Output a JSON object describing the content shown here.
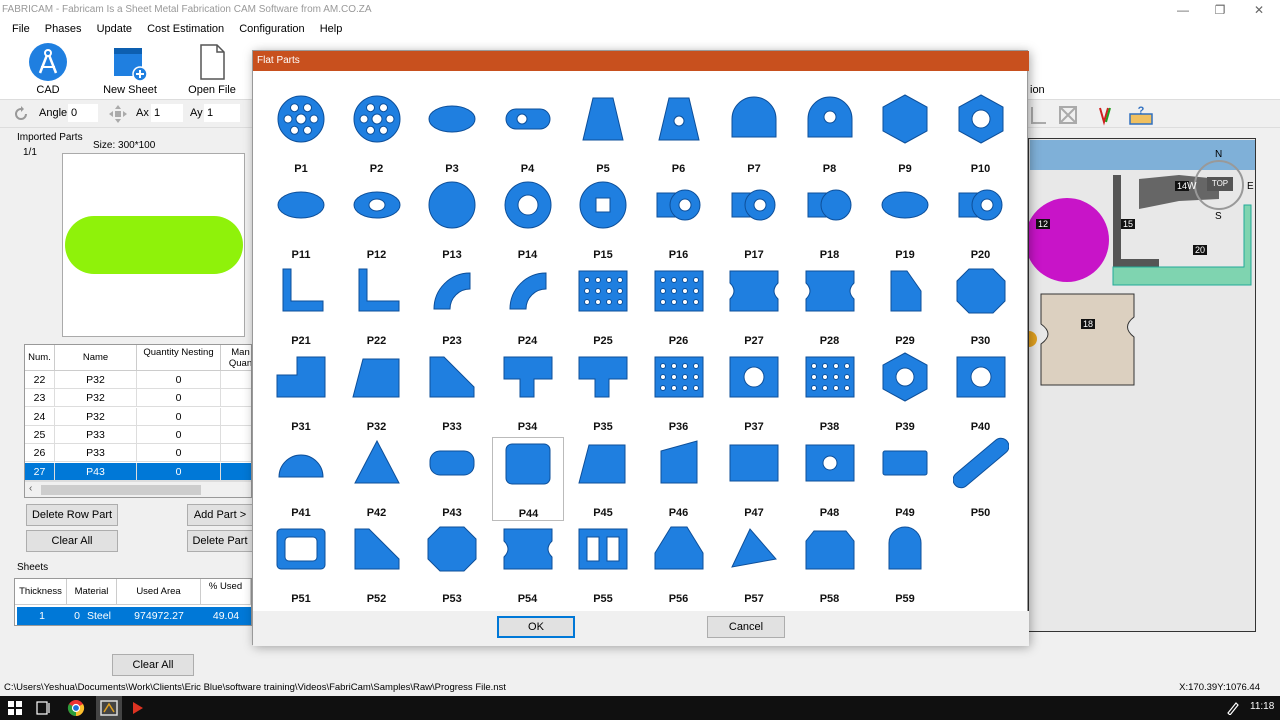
{
  "window": {
    "title": "FABRICAM - Fabricam Is a Sheet Metal Fabrication CAM Software from AM.CO.ZA",
    "minimize": "—",
    "maximize": "❐",
    "close": "✕"
  },
  "menu": [
    "File",
    "Phases",
    "Update",
    "Cost Estimation",
    "Configuration",
    "Help"
  ],
  "ribbon": {
    "cad": "CAD",
    "new_sheet": "New Sheet",
    "open_file": "Open File",
    "partial_label": "ion"
  },
  "toolrow": {
    "angle_label": "Angle",
    "angle_value": "0",
    "ax_label": "Ax",
    "ax_value": "1",
    "ay_label": "Ay",
    "ay_value": "1"
  },
  "imported": {
    "title": "Imported Parts",
    "page": "1/1",
    "size": "Size: 300*100"
  },
  "parts_table": {
    "headers": [
      "Num.",
      "Name",
      "Quantity Nesting",
      "Man Quan"
    ],
    "rows": [
      {
        "num": "22",
        "name": "P32",
        "qty": "0"
      },
      {
        "num": "23",
        "name": "P32",
        "qty": "0"
      },
      {
        "num": "24",
        "name": "P32",
        "qty": "0"
      },
      {
        "num": "25",
        "name": "P33",
        "qty": "0"
      },
      {
        "num": "26",
        "name": "P33",
        "qty": "0"
      },
      {
        "num": "27",
        "name": "P43",
        "qty": "0"
      }
    ],
    "selected_row": 5
  },
  "buttons": {
    "delete_row_part": "Delete Row Part",
    "add_part": "Add Part >",
    "clear_all": "Clear All",
    "delete_part": "Delete Part",
    "sheets_clear_all": "Clear All"
  },
  "sheets": {
    "title": "Sheets",
    "headers": [
      "Thickness",
      "Material",
      "Used Area",
      "% Used"
    ],
    "row": {
      "thickness": "1",
      "material_id": "0",
      "material": "Steel",
      "used_area": "974972.27",
      "used": "49.04"
    }
  },
  "canvas": {
    "labels": [
      "12",
      "15",
      "14",
      "20",
      "18"
    ],
    "compass": {
      "n": "N",
      "s": "S",
      "w": "W",
      "e": "E",
      "top": "TOP"
    }
  },
  "dialog": {
    "title": "Flat Parts",
    "ok": "OK",
    "cancel": "Cancel",
    "selected_part": "P44",
    "parts": [
      "P1",
      "P2",
      "P3",
      "P4",
      "P5",
      "P6",
      "P7",
      "P8",
      "P9",
      "P10",
      "P11",
      "P12",
      "P13",
      "P14",
      "P15",
      "P16",
      "P17",
      "P18",
      "P19",
      "P20",
      "P21",
      "P22",
      "P23",
      "P24",
      "P25",
      "P26",
      "P27",
      "P28",
      "P29",
      "P30",
      "P31",
      "P32",
      "P33",
      "P34",
      "P35",
      "P36",
      "P37",
      "P38",
      "P39",
      "P40",
      "P41",
      "P42",
      "P43",
      "P44",
      "P45",
      "P46",
      "P47",
      "P48",
      "P49",
      "P50",
      "P51",
      "P52",
      "P53",
      "P54",
      "P55",
      "P56",
      "P57",
      "P58",
      "P59"
    ]
  },
  "status": {
    "path": "C:\\Users\\Yeshua\\Documents\\Work\\Clients\\Eric Blue\\software training\\Videos\\FabriCam\\Samples\\Raw\\Progress File.nst",
    "coords": "X:170.39Y:1076.44"
  },
  "taskbar": {
    "time": "11:18"
  },
  "colors": {
    "part_blue": "#1f7fe0",
    "dialog_title": "#c8501e",
    "selection": "#0078d7",
    "preview_green": "#8ff20a"
  }
}
